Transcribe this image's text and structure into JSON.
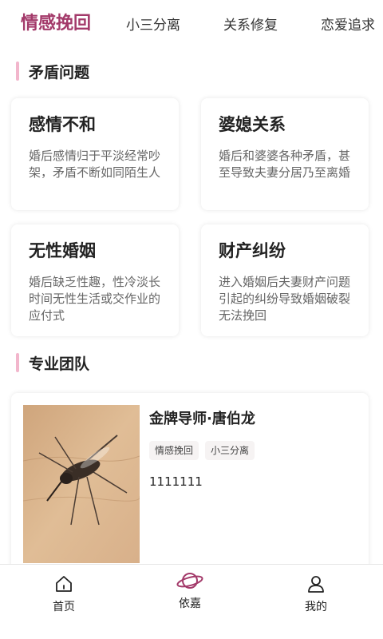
{
  "colors": {
    "accent": "#a33a6a",
    "section_bar": "#f2b6cc"
  },
  "tabs": [
    {
      "label": "情感挽回",
      "active": true
    },
    {
      "label": "小三分离",
      "active": false
    },
    {
      "label": "关系修复",
      "active": false
    },
    {
      "label": "恋爱追求",
      "active": false
    }
  ],
  "sections": {
    "problems_title": "矛盾问题",
    "team_title": "专业团队"
  },
  "problems": [
    {
      "title": "感情不和",
      "desc": "婚后感情归于平淡经常吵架，矛盾不断如同陌生人"
    },
    {
      "title": "婆媳关系",
      "desc": "婚后和婆婆各种矛盾，甚至导致夫妻分居乃至离婚"
    },
    {
      "title": "无性婚姻",
      "desc": "婚后缺乏性趣，性冷淡长时间无性生活或交作业的应付式"
    },
    {
      "title": "财产纠纷",
      "desc": "进入婚姻后夫妻财产问题引起的纠纷导致婚姻破裂无法挽回"
    }
  ],
  "team": {
    "name": "金牌导师·唐伯龙",
    "tags": [
      "情感挽回",
      "小三分离"
    ],
    "note": "1111111",
    "photo_icon": "mosquito-photo"
  },
  "nav": [
    {
      "label": "首页",
      "icon": "home-icon",
      "active": false
    },
    {
      "label": "依嘉",
      "icon": "planet-icon",
      "active": true
    },
    {
      "label": "我的",
      "icon": "user-icon",
      "active": false
    }
  ]
}
